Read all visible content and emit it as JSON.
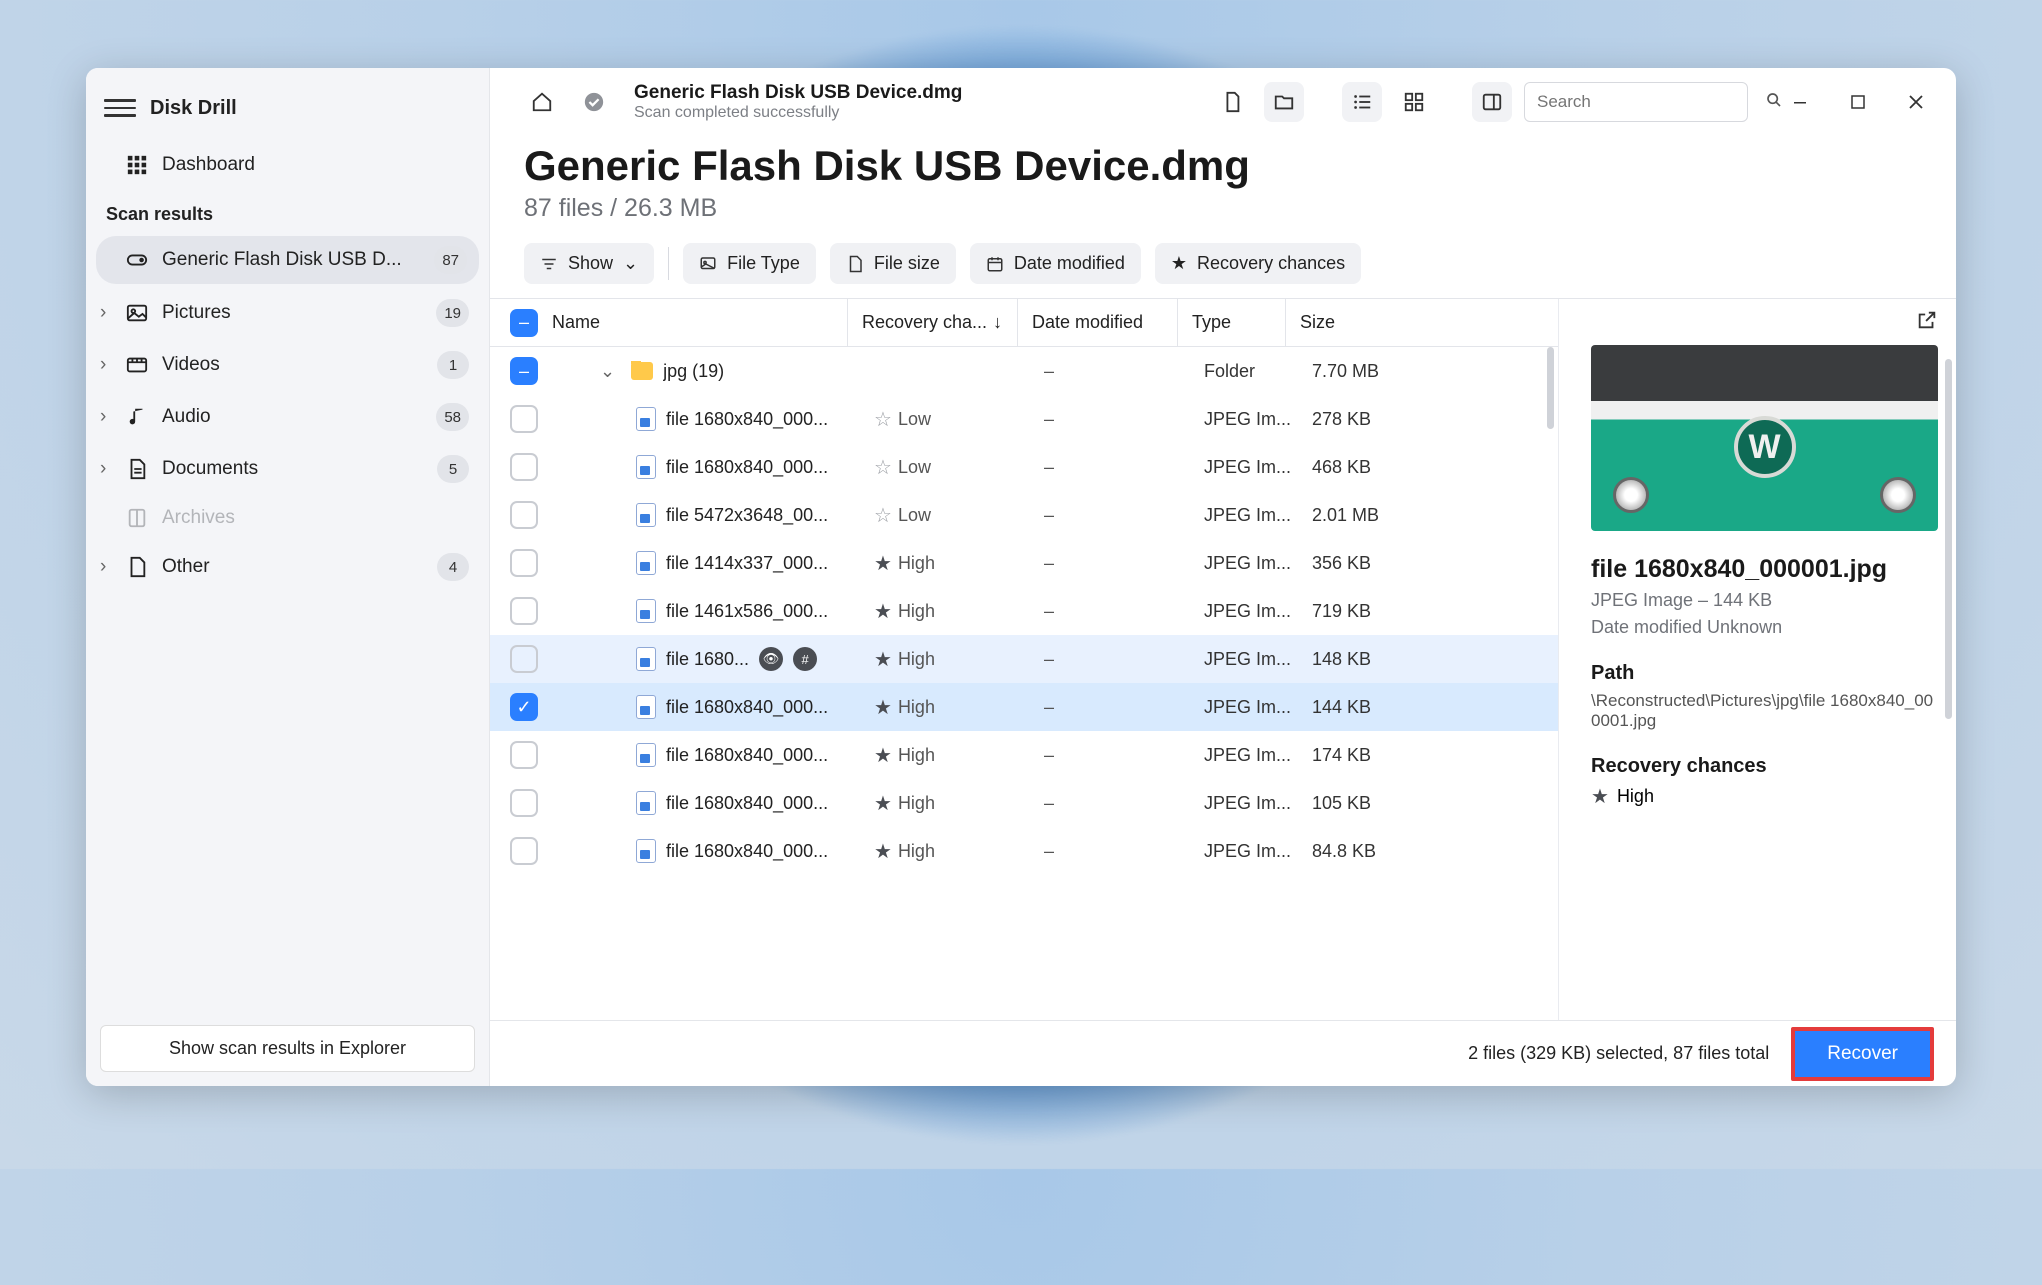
{
  "app": {
    "title": "Disk Drill"
  },
  "sidebar": {
    "dashboard": "Dashboard",
    "section_label": "Scan results",
    "items": [
      {
        "label": "Generic Flash Disk USB D...",
        "count": "87",
        "active": true
      },
      {
        "label": "Pictures",
        "count": "19"
      },
      {
        "label": "Videos",
        "count": "1"
      },
      {
        "label": "Audio",
        "count": "58"
      },
      {
        "label": "Documents",
        "count": "5"
      },
      {
        "label": "Archives",
        "disabled": true
      },
      {
        "label": "Other",
        "count": "4"
      }
    ],
    "footer_button": "Show scan results in Explorer"
  },
  "toolbar": {
    "path_title": "Generic Flash Disk USB Device.dmg",
    "path_status": "Scan completed successfully",
    "search_placeholder": "Search"
  },
  "heading": {
    "title": "Generic Flash Disk USB Device.dmg",
    "subtitle": "87 files / 26.3 MB"
  },
  "chips": {
    "show": "Show",
    "file_type": "File Type",
    "file_size": "File size",
    "date_modified": "Date modified",
    "recovery_chances": "Recovery chances"
  },
  "columns": {
    "name": "Name",
    "recovery": "Recovery cha...",
    "date": "Date modified",
    "type": "Type",
    "size": "Size"
  },
  "rows": [
    {
      "kind": "folder",
      "name": "jpg (19)",
      "recovery": "",
      "date": "–",
      "type": "Folder",
      "size": "7.70 MB",
      "checked": "partial"
    },
    {
      "kind": "file",
      "name": "file 1680x840_000...",
      "recovery": "Low",
      "star": "outline",
      "date": "–",
      "type": "JPEG Im...",
      "size": "278 KB"
    },
    {
      "kind": "file",
      "name": "file 1680x840_000...",
      "recovery": "Low",
      "star": "outline",
      "date": "–",
      "type": "JPEG Im...",
      "size": "468 KB"
    },
    {
      "kind": "file",
      "name": "file 5472x3648_00...",
      "recovery": "Low",
      "star": "outline",
      "date": "–",
      "type": "JPEG Im...",
      "size": "2.01 MB"
    },
    {
      "kind": "file",
      "name": "file 1414x337_000...",
      "recovery": "High",
      "star": "filled",
      "date": "–",
      "type": "JPEG Im...",
      "size": "356 KB"
    },
    {
      "kind": "file",
      "name": "file 1461x586_000...",
      "recovery": "High",
      "star": "filled",
      "date": "–",
      "type": "JPEG Im...",
      "size": "719 KB"
    },
    {
      "kind": "file",
      "name": "file 1680...",
      "recovery": "High",
      "star": "filled",
      "date": "–",
      "type": "JPEG Im...",
      "size": "148 KB",
      "highlight": true,
      "badges": true
    },
    {
      "kind": "file",
      "name": "file 1680x840_000...",
      "recovery": "High",
      "star": "filled",
      "date": "–",
      "type": "JPEG Im...",
      "size": "144 KB",
      "checked": true,
      "selected": true
    },
    {
      "kind": "file",
      "name": "file 1680x840_000...",
      "recovery": "High",
      "star": "filled",
      "date": "–",
      "type": "JPEG Im...",
      "size": "174 KB"
    },
    {
      "kind": "file",
      "name": "file 1680x840_000...",
      "recovery": "High",
      "star": "filled",
      "date": "–",
      "type": "JPEG Im...",
      "size": "105 KB"
    },
    {
      "kind": "file",
      "name": "file 1680x840_000...",
      "recovery": "High",
      "star": "filled",
      "date": "–",
      "type": "JPEG Im...",
      "size": "84.8 KB"
    }
  ],
  "details": {
    "filename": "file 1680x840_000001.jpg",
    "meta": "JPEG Image – 144 KB",
    "date_mod": "Date modified Unknown",
    "path_label": "Path",
    "path_value": "\\Reconstructed\\Pictures\\jpg\\file 1680x840_000001.jpg",
    "recovery_label": "Recovery chances",
    "recovery_value": "High"
  },
  "footer": {
    "selection": "2 files (329 KB) selected, 87 files total",
    "recover": "Recover"
  }
}
